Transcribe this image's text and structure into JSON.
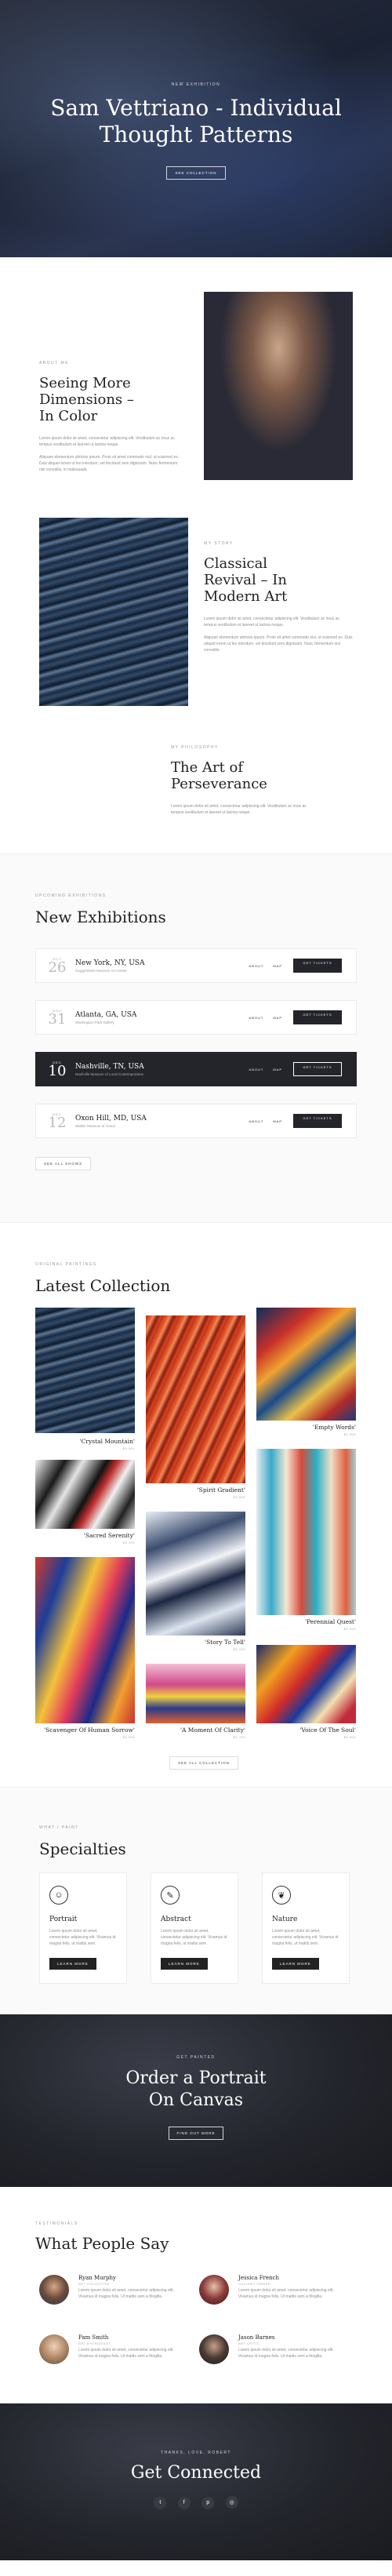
{
  "hero": {
    "eyebrow": "NEW EXHIBITION",
    "title_line1": "Sam Vettriano - Individual",
    "title_line2": "Thought Patterns",
    "button": "SEE COLLECTION"
  },
  "about": {
    "eyebrow": "ABOUT ME",
    "title": "Seeing More Dimensions – In Color",
    "para1": "Lorem ipsum dolor sit amet, consectetur adipiscing elit. Vestibulum ac risus ac tempus vestibulum et laoreet ut lacinia neque.",
    "para2": "Aliquam elementum ultricies ipsum. Proin sit amet commodo nisl, ut euismod ex. Duis aliquet lorem ut leo interdum, vel tincidunt sem dignissim. Nunc fermentum nisl convallis, in malesuada."
  },
  "revival": {
    "eyebrow": "MY STORY",
    "title": "Classical Revival – In Modern Art",
    "para1": "Lorem ipsum dolor sit amet, consectetur adipiscing elit. Vestibulum ac risus ac tempus vestibulum et laoreet ut lacinia neque.",
    "para2": "Aliquam elementum ultricies ipsum. Proin sit amet commodo nisl, ut euismod ex. Duis aliquet lorem ut leo interdum, vel tincidunt sem dignissim. Nunc fermentum nisl convallis."
  },
  "perseverance": {
    "eyebrow": "MY PHILOSOPHY",
    "title": "The Art of Perseverance",
    "para1": "Lorem ipsum dolor sit amet, consectetur adipiscing elit. Vestibulum ac risus ac tempus vestibulum et laoreet ut lacinia neque."
  },
  "exhibitions": {
    "eyebrow": "UPCOMING EXHIBITIONS",
    "title": "New Exhibitions",
    "link_about": "ABOUT",
    "link_map": "MAP",
    "ticket_label": "GET TICKETS",
    "see_all": "SEE ALL SHOWS",
    "items": [
      {
        "month": "OCT",
        "day": "26",
        "city": "New York, NY, USA",
        "venue": "Guggenheim Museum Art Center"
      },
      {
        "month": "NOV",
        "day": "31",
        "city": "Atlanta, GA, USA",
        "venue": "Washington Park Gallery"
      },
      {
        "month": "DEC",
        "day": "10",
        "city": "Nashville, TN, USA",
        "venue": "Nashville Museum of Local Contemporaries"
      },
      {
        "month": "DEC",
        "day": "12",
        "city": "Oxon Hill, MD, USA",
        "venue": "Walker Museum of Visual"
      }
    ]
  },
  "collection": {
    "eyebrow": "ORIGINAL PAINTINGS",
    "title": "Latest Collection",
    "button": "SEE ALL COLLECTION",
    "items": [
      {
        "title": "'Crystal Mountain'",
        "price": "$4,500"
      },
      {
        "title": "'Spirit Gradient'",
        "price": "$3,800"
      },
      {
        "title": "'Empty Words'",
        "price": "$2,900"
      },
      {
        "title": "'Sacred Serenity'",
        "price": "$3,200"
      },
      {
        "title": "'Story To Tell'",
        "price": "$5,100"
      },
      {
        "title": "'Perennial Quest'",
        "price": "$4,200"
      },
      {
        "title": "'Scavenger Of Human Sorrow'",
        "price": "$6,000"
      },
      {
        "title": "'A Moment Of Clarity'",
        "price": "$2,700"
      },
      {
        "title": "'Voice Of The Soul'",
        "price": "$3,900"
      }
    ]
  },
  "specialties": {
    "eyebrow": "WHAT I PAINT",
    "title": "Specialties",
    "button": "LEARN MORE",
    "items": [
      {
        "title": "Portrait",
        "icon": "face-icon",
        "text": "Lorem ipsum dolor sit amet, consectetur adipiscing elit. Vivamus id magna felis, ut mattis sem."
      },
      {
        "title": "Abstract",
        "icon": "abstract-icon",
        "text": "Lorem ipsum dolor sit amet, consectetur adipiscing elit. Vivamus id magna felis, ut mattis sem."
      },
      {
        "title": "Nature",
        "icon": "leaf-icon",
        "text": "Lorem ipsum dolor sit amet, consectetur adipiscing elit. Vivamus id magna felis, ut mattis sem."
      }
    ]
  },
  "portrait_cta": {
    "eyebrow": "GET PAINTED",
    "title_line1": "Order a Portrait",
    "title_line2": "On Canvas",
    "button": "FIND OUT MORE"
  },
  "testimonials": {
    "eyebrow": "TESTIMONIALS",
    "title": "What People Say",
    "items": [
      {
        "name": "Ryan Murphy",
        "role": "ART COLLECTOR",
        "text": "Lorem ipsum dolor sit amet, consectetur adipiscing elit. Vivamus id magna felis. Ut mattis sem a fringilla."
      },
      {
        "name": "Jessica French",
        "role": "GALLERY OWNER",
        "text": "Lorem ipsum dolor sit amet, consectetur adipiscing elit. Vivamus id magna felis. Ut mattis sem a fringilla."
      },
      {
        "name": "Pam Smith",
        "role": "ART ENTHUSIAST",
        "text": "Lorem ipsum dolor sit amet, consectetur adipiscing elit. Vivamus id magna felis. Ut mattis sem a fringilla."
      },
      {
        "name": "Jason Barnes",
        "role": "ART CRITIC",
        "text": "Lorem ipsum dolor sit amet, consectetur adipiscing elit. Vivamus id magna felis. Ut mattis sem a fringilla."
      }
    ]
  },
  "footer": {
    "eyebrow": "THANKS, LOVE, ROBERT",
    "title": "Get Connected",
    "social": [
      {
        "icon": "twitter-icon",
        "glyph": "t"
      },
      {
        "icon": "facebook-icon",
        "glyph": "f"
      },
      {
        "icon": "pinterest-icon",
        "glyph": "p"
      },
      {
        "icon": "instagram-icon",
        "glyph": "◎"
      }
    ]
  }
}
